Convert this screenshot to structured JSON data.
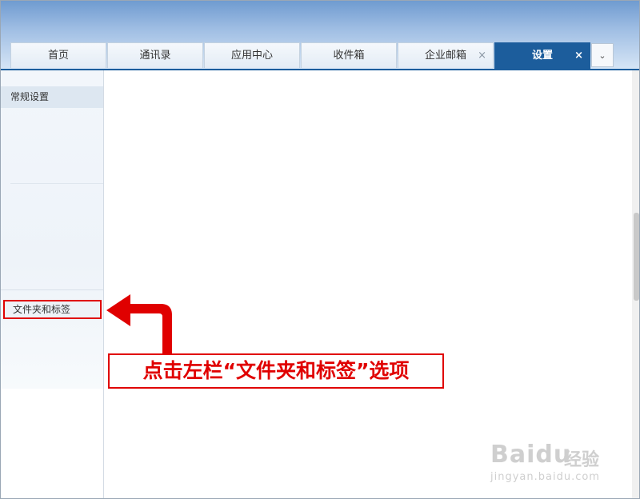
{
  "tabs": [
    {
      "label": "首页",
      "active": false,
      "closable": false
    },
    {
      "label": "通讯录",
      "active": false,
      "closable": false
    },
    {
      "label": "应用中心",
      "active": false,
      "closable": false
    },
    {
      "label": "收件箱",
      "active": false,
      "closable": false
    },
    {
      "label": "企业邮箱",
      "active": false,
      "closable": true
    },
    {
      "label": "设置",
      "active": true,
      "closable": true
    }
  ],
  "close_glyph": "×",
  "tab_dropdown": "⌄",
  "sidebar": {
    "general_settings": "常规设置",
    "folders_and_tags": "文件夹和标签"
  },
  "annotation": {
    "text": "点击左栏“文件夹和标签”选项",
    "color": "#e00000"
  },
  "watermark": {
    "logo_left": "Bai",
    "logo_right": "du",
    "brand": "经验",
    "url": "jingyan.baidu.com"
  },
  "colors": {
    "active_tab": "#1c5d9c",
    "sidebar_selected": "#dde7f1"
  }
}
